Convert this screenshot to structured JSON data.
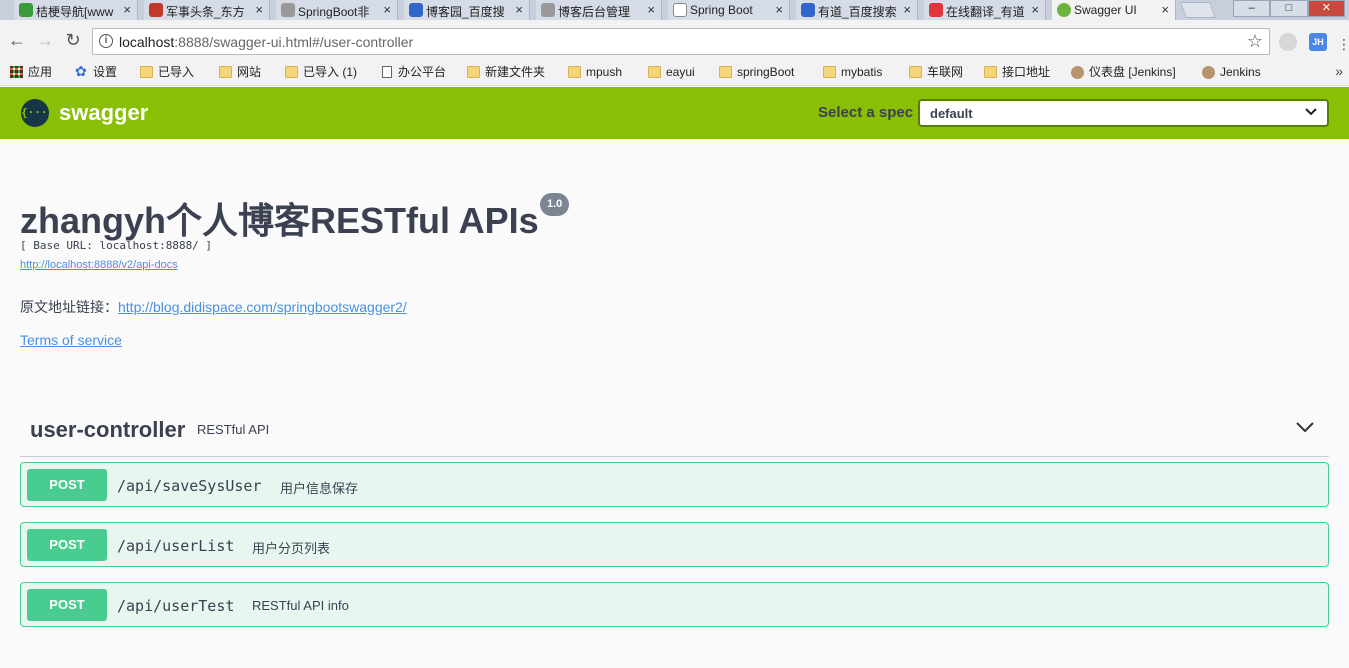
{
  "browser": {
    "tabs": [
      {
        "title": "桔梗导航[www",
        "color": "#3a9a3a"
      },
      {
        "title": "军事头条_东方",
        "color": "#c0392b"
      },
      {
        "title": "SpringBoot非",
        "color": "#777777"
      },
      {
        "title": "博客园_百度搜",
        "color": "#3366cc"
      },
      {
        "title": "博客后台管理",
        "color": "#777777"
      },
      {
        "title": "Spring Boot",
        "color": "#ffffff"
      },
      {
        "title": "有道_百度搜索",
        "color": "#3366cc"
      },
      {
        "title": "在线翻译_有道",
        "color": "#e0353b"
      },
      {
        "title": "Swagger UI",
        "color": "#6db33f"
      }
    ],
    "tab_close_glyph": "×",
    "window_buttons": [
      "–",
      "□",
      "✕"
    ],
    "url_host": "localhost",
    "url_rest": ":8888/swagger-ui.html#/user-controller",
    "ext_label": "JH",
    "bookmarks": [
      {
        "label": "应用",
        "icon": "apps-icon"
      },
      {
        "label": "设置",
        "icon": "gear-icon"
      },
      {
        "label": "已导入",
        "icon": "folder-icon"
      },
      {
        "label": "网站",
        "icon": "folder-icon"
      },
      {
        "label": "已导入 (1)",
        "icon": "folder-icon"
      },
      {
        "label": "办公平台",
        "icon": "document-icon"
      },
      {
        "label": "新建文件夹",
        "icon": "folder-icon"
      },
      {
        "label": "mpush",
        "icon": "folder-icon"
      },
      {
        "label": "eayui",
        "icon": "folder-icon"
      },
      {
        "label": "springBoot",
        "icon": "folder-icon"
      },
      {
        "label": "mybatis",
        "icon": "folder-icon"
      },
      {
        "label": "车联网",
        "icon": "folder-icon"
      },
      {
        "label": "接口地址",
        "icon": "folder-icon"
      },
      {
        "label": "仪表盘 [Jenkins]",
        "icon": "avatar-icon"
      },
      {
        "label": "Jenkins",
        "icon": "avatar-icon"
      }
    ]
  },
  "swagger": {
    "logo_text": "swagger",
    "logo_glyph": "{···}",
    "spec_label": "Select a spec",
    "spec_value": "default",
    "brand_color": "#89bf04"
  },
  "info": {
    "title": "zhangyh个人博客RESTful APIs",
    "version": "1.0",
    "base_url": "[ Base URL: localhost:8888/ ]",
    "docs_url": "http://localhost:8888/v2/api-docs",
    "description_prefix": "原文地址链接：",
    "description_link": "http://blog.didispace.com/springbootswagger2/",
    "terms": "Terms of service"
  },
  "tag": {
    "name": "user-controller",
    "description": "RESTful API",
    "operations": [
      {
        "method": "POST",
        "path": "/api/saveSysUser",
        "summary": "用户信息保存"
      },
      {
        "method": "POST",
        "path": "/api/userList",
        "summary": "用户分页列表"
      },
      {
        "method": "POST",
        "path": "/api/userTest",
        "summary": "RESTful API info"
      }
    ]
  }
}
